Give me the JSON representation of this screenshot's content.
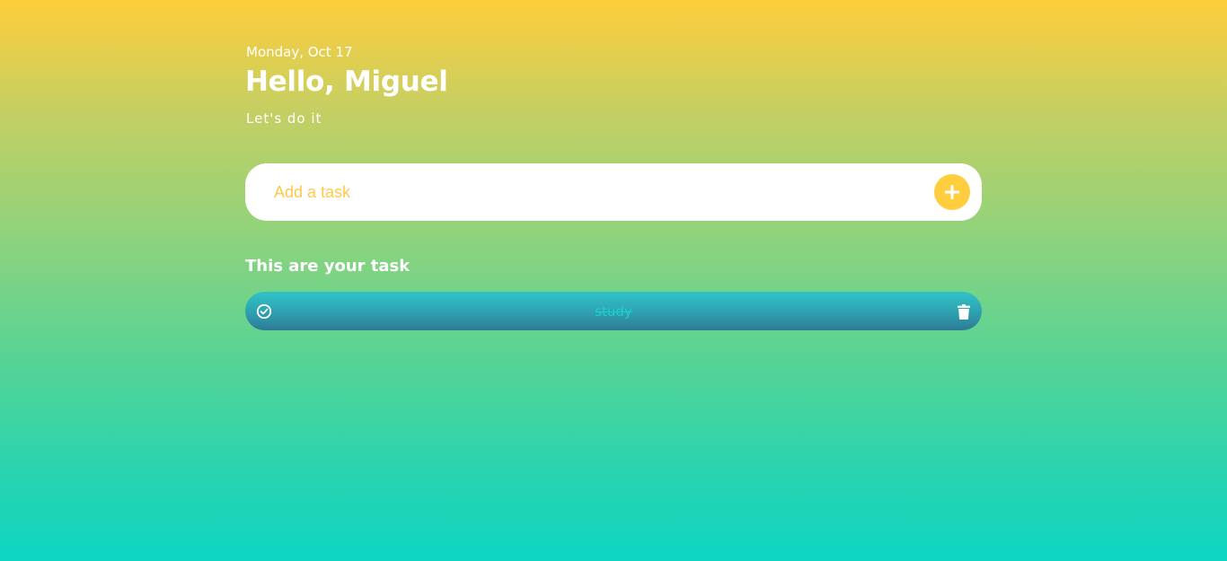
{
  "header": {
    "date": "Monday, Oct 17",
    "greeting": "Hello, Miguel",
    "tagline": "Let's do it"
  },
  "add_task": {
    "placeholder": "Add a task",
    "value": "",
    "button_icon": "plus-icon"
  },
  "tasks_section": {
    "title": "This are your task",
    "items": [
      {
        "text": "study",
        "completed": true,
        "check_icon": "check-circle-icon",
        "delete_icon": "trash-icon"
      }
    ]
  },
  "colors": {
    "background_top": "#FFCE3C",
    "background_bottom": "#0DD5C2",
    "accent": "#FFCD3E",
    "task_bar": "#2FA0B0",
    "completed_text": "#1ECFC9"
  }
}
